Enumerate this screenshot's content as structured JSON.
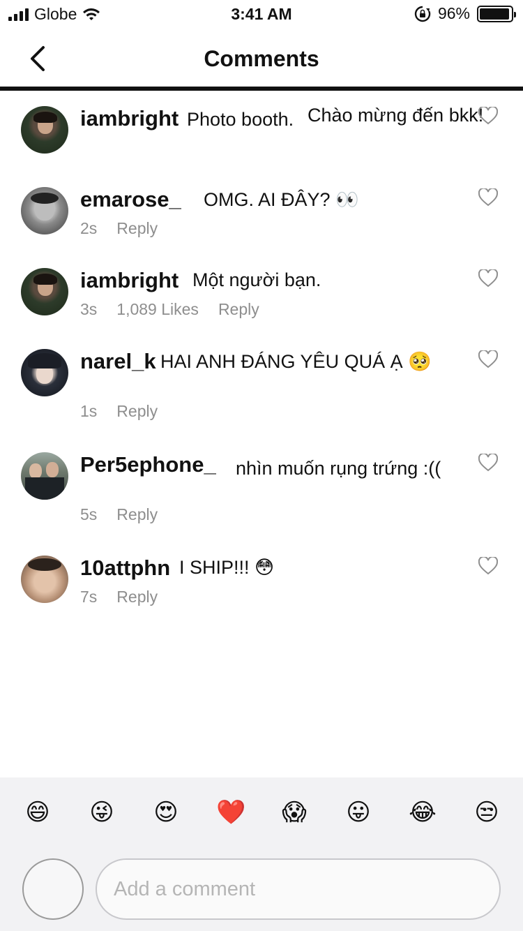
{
  "status_bar": {
    "carrier": "Globe",
    "time": "3:41 AM",
    "battery_text": "96%",
    "battery_level": 0.96,
    "icons": [
      "signal-icon",
      "wifi-icon",
      "orientation-lock-icon",
      "battery-icon"
    ]
  },
  "nav": {
    "title": "Comments",
    "back_icon": "chevron-left-icon"
  },
  "comments": [
    {
      "username": "iambright",
      "text": "Photo booth.",
      "text2": "Chào mừng đến bkk!",
      "time": "",
      "likes": "",
      "reply": ""
    },
    {
      "username": "emarose_",
      "text": "OMG. AI ĐÂY? 👀",
      "time": "2s",
      "likes": "",
      "reply": "Reply"
    },
    {
      "username": "iambright",
      "text": "Một người bạn.",
      "time": "3s",
      "likes": "1,089 Likes",
      "reply": "Reply"
    },
    {
      "username": "narel_k",
      "text": "HAI ANH ĐÁNG YÊU QUÁ Ạ 🥺",
      "time": "1s",
      "likes": "",
      "reply": "Reply"
    },
    {
      "username": "Per5ephone_",
      "text": "nhìn muốn rụng trứng :((",
      "time": "5s",
      "likes": "",
      "reply": "Reply"
    },
    {
      "username": "10attphn",
      "text": "I SHIP!!! 😳",
      "time": "7s",
      "likes": "",
      "reply": "Reply"
    }
  ],
  "emoji_bar": [
    "😄",
    "😜",
    "😍",
    "❤️",
    "😱",
    "😛",
    "😂",
    "😒"
  ],
  "composer": {
    "placeholder": "Add a comment"
  },
  "colors": {
    "muted": "#8e8e8e",
    "composer_bg": "#f2f2f4",
    "heart_red": "#e0202b"
  }
}
